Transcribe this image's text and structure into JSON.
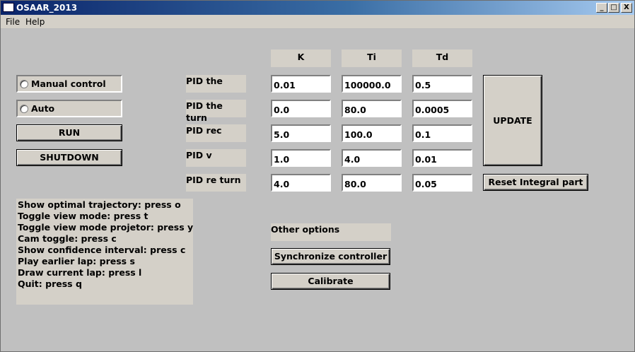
{
  "window": {
    "title": "OSAAR_2013"
  },
  "titlebar_buttons": {
    "minimize": "_",
    "maximize": "□",
    "close": "X"
  },
  "menu": {
    "file": "File",
    "help": "Help"
  },
  "control": {
    "manual_label": "Manual control",
    "auto_label": "Auto",
    "run_label": "RUN",
    "shutdown_label": "SHUTDOWN"
  },
  "pid": {
    "headers": {
      "k": "K",
      "ti": "Ti",
      "td": "Td"
    },
    "rows": [
      {
        "label": "PID the",
        "k": "0.01",
        "ti": "100000.0",
        "td": "0.5"
      },
      {
        "label": "PID the turn",
        "k": "0.0",
        "ti": "80.0",
        "td": "0.0005"
      },
      {
        "label": "PID rec",
        "k": "5.0",
        "ti": "100.0",
        "td": "0.1"
      },
      {
        "label": "PID v",
        "k": "1.0",
        "ti": "4.0",
        "td": "0.01"
      },
      {
        "label": "PID re turn",
        "k": "4.0",
        "ti": "80.0",
        "td": "0.05"
      }
    ],
    "update_label": "UPDATE",
    "reset_label": "Reset Integral part"
  },
  "help_lines": [
    "Show optimal trajectory: press o",
    "Toggle view mode: press t",
    "Toggle view mode projetor: press y",
    "Cam toggle: press c",
    "Show confidence interval: press c",
    "Play earlier lap: press s",
    "Draw current lap: press l",
    "Quit: press q"
  ],
  "other": {
    "title": "Other options",
    "sync_label": "Synchronize controller",
    "calibrate_label": "Calibrate"
  }
}
